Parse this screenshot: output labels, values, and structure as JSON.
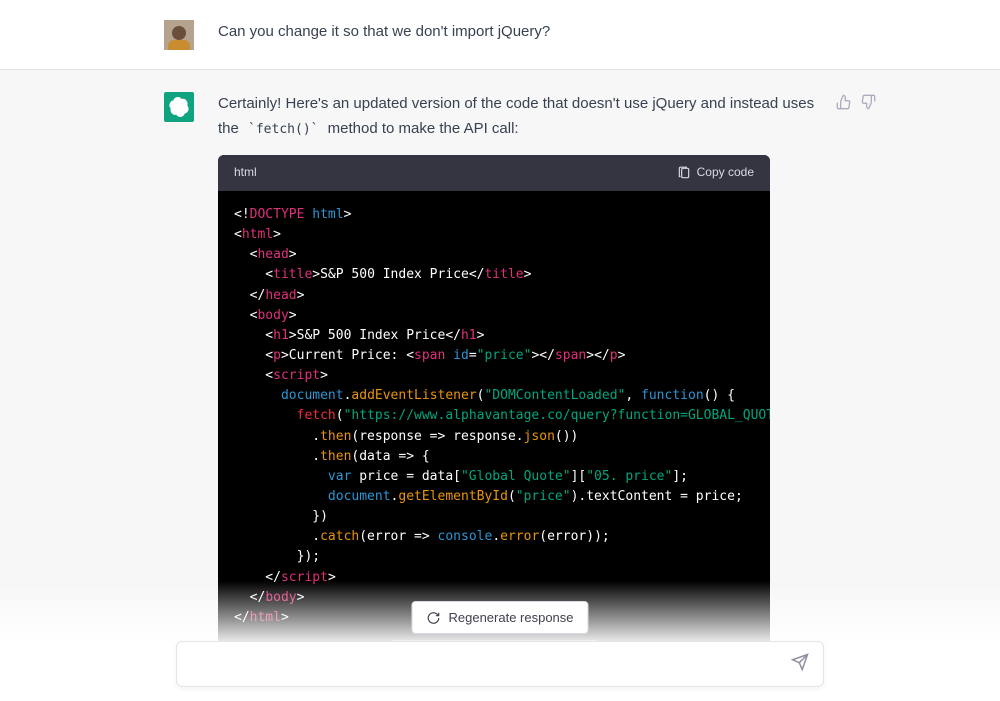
{
  "user_message": "Can you change it so that we don't import jQuery?",
  "assistant_intro_1": "Certainly! Here's an updated version of the code that doesn't use jQuery and instead uses the ",
  "assistant_intro_code": "`fetch()`",
  "assistant_intro_2": " method to make the API call:",
  "code": {
    "language": "html",
    "copy_label": "Copy code",
    "lines": [
      [
        [
          "white",
          "<!"
        ],
        [
          "pink",
          "DOCTYPE"
        ],
        [
          "white",
          " "
        ],
        [
          "blue",
          "html"
        ],
        [
          "white",
          ">"
        ]
      ],
      [
        [
          "white",
          "<"
        ],
        [
          "pink",
          "html"
        ],
        [
          "white",
          ">"
        ]
      ],
      [
        [
          "white",
          "  <"
        ],
        [
          "pink",
          "head"
        ],
        [
          "white",
          ">"
        ]
      ],
      [
        [
          "white",
          "    <"
        ],
        [
          "pink",
          "title"
        ],
        [
          "white",
          ">S&P 500 Index Price</"
        ],
        [
          "pink",
          "title"
        ],
        [
          "white",
          ">"
        ]
      ],
      [
        [
          "white",
          "  </"
        ],
        [
          "pink",
          "head"
        ],
        [
          "white",
          ">"
        ]
      ],
      [
        [
          "white",
          "  <"
        ],
        [
          "pink",
          "body"
        ],
        [
          "white",
          ">"
        ]
      ],
      [
        [
          "white",
          "    <"
        ],
        [
          "pink",
          "h1"
        ],
        [
          "white",
          ">S&P 500 Index Price</"
        ],
        [
          "pink",
          "h1"
        ],
        [
          "white",
          ">"
        ]
      ],
      [
        [
          "white",
          "    <"
        ],
        [
          "pink",
          "p"
        ],
        [
          "white",
          ">Current Price: <"
        ],
        [
          "pink",
          "span"
        ],
        [
          "white",
          " "
        ],
        [
          "blue",
          "id"
        ],
        [
          "white",
          "="
        ],
        [
          "teal",
          "\"price\""
        ],
        [
          "white",
          "></"
        ],
        [
          "pink",
          "span"
        ],
        [
          "white",
          "></"
        ],
        [
          "pink",
          "p"
        ],
        [
          "white",
          ">"
        ]
      ],
      [
        [
          "white",
          "    <"
        ],
        [
          "pink",
          "script"
        ],
        [
          "white",
          ">"
        ]
      ],
      [
        [
          "white",
          "      "
        ],
        [
          "cyan",
          "document"
        ],
        [
          "white",
          "."
        ],
        [
          "fn",
          "addEventListener"
        ],
        [
          "white",
          "("
        ],
        [
          "teal",
          "\"DOMContentLoaded\""
        ],
        [
          "white",
          ", "
        ],
        [
          "blue",
          "function"
        ],
        [
          "white",
          "() {"
        ]
      ],
      [
        [
          "white",
          "        "
        ],
        [
          "func",
          "fetch"
        ],
        [
          "white",
          "("
        ],
        [
          "teal",
          "\"https://www.alphavantage.co/query?function=GLOBAL_QUOTE&symbol=^GSPC"
        ]
      ],
      [
        [
          "white",
          "          ."
        ],
        [
          "fn",
          "then"
        ],
        [
          "white",
          "(response => response."
        ],
        [
          "fn",
          "json"
        ],
        [
          "white",
          "())"
        ]
      ],
      [
        [
          "white",
          "          ."
        ],
        [
          "fn",
          "then"
        ],
        [
          "white",
          "(data => {"
        ]
      ],
      [
        [
          "white",
          "            "
        ],
        [
          "blue",
          "var"
        ],
        [
          "white",
          " price = data["
        ],
        [
          "teal",
          "\"Global Quote\""
        ],
        [
          "white",
          "]["
        ],
        [
          "teal",
          "\"05. price\""
        ],
        [
          "white",
          "];"
        ]
      ],
      [
        [
          "white",
          "            "
        ],
        [
          "cyan",
          "document"
        ],
        [
          "white",
          "."
        ],
        [
          "fn",
          "getElementById"
        ],
        [
          "white",
          "("
        ],
        [
          "teal",
          "\"price\""
        ],
        [
          "white",
          ").textContent = price;"
        ]
      ],
      [
        [
          "white",
          "          })"
        ]
      ],
      [
        [
          "white",
          "          ."
        ],
        [
          "fn",
          "catch"
        ],
        [
          "white",
          "(error => "
        ],
        [
          "cyan",
          "console"
        ],
        [
          "white",
          "."
        ],
        [
          "fn",
          "error"
        ],
        [
          "white",
          "(error));"
        ]
      ],
      [
        [
          "white",
          "        });"
        ]
      ],
      [
        [
          "white",
          "    </"
        ],
        [
          "pink",
          "script"
        ],
        [
          "white",
          ">"
        ]
      ],
      [
        [
          "white",
          "  </"
        ],
        [
          "pink",
          "body"
        ],
        [
          "white",
          ">"
        ]
      ],
      [
        [
          "white",
          "</"
        ],
        [
          "pink",
          "html"
        ],
        [
          "white",
          ">"
        ]
      ]
    ]
  },
  "regenerate_label": "Regenerate response",
  "input_placeholder": ""
}
